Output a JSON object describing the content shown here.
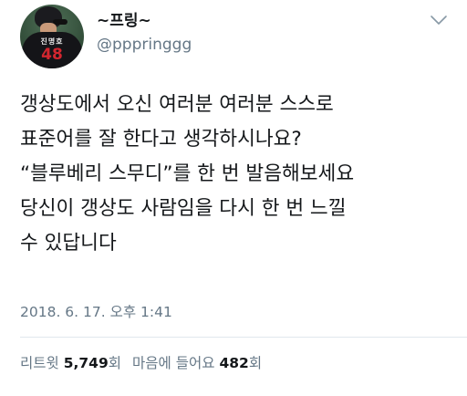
{
  "user": {
    "display_name": "~프링~",
    "handle": "@pppringgg",
    "avatar_jersey_name": "진명호",
    "avatar_jersey_number": "48"
  },
  "tweet": {
    "lines": [
      "갱상도에서 오신 여러분 여러분 스스로",
      "표준어를 잘 한다고 생각하시나요?",
      "“블루베리 스무디”를 한 번 발음해보세요",
      "당신이 갱상도 사람임을 다시 한 번 느낄",
      "수 있답니다"
    ],
    "timestamp": "2018. 6. 17. 오후 1:41"
  },
  "stats": {
    "retweets_label": "리트윗",
    "retweets_count": "5,749",
    "retweets_suffix": "회",
    "likes_label": "마음에 들어요",
    "likes_count": "482",
    "likes_suffix": "회"
  },
  "icons": {
    "menu": "chevron-down-icon"
  },
  "colors": {
    "text": "#14171a",
    "secondary": "#657786",
    "divider": "#e1e8ed",
    "jersey_number": "#d2262f"
  }
}
